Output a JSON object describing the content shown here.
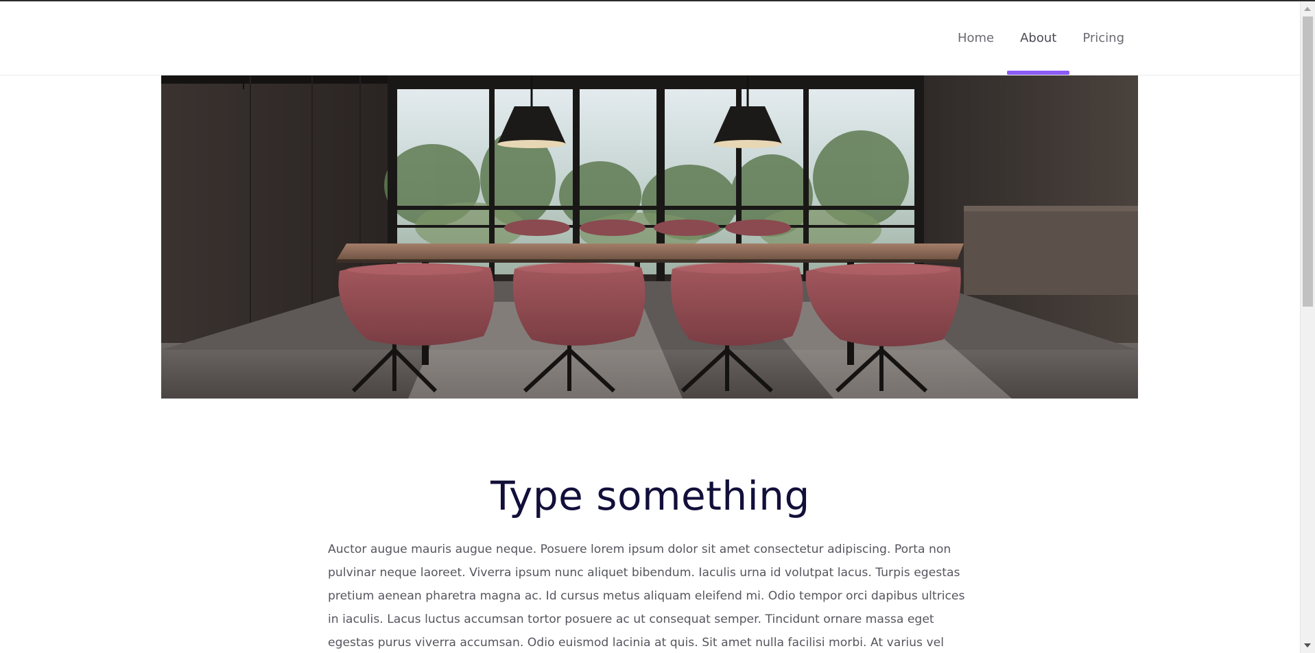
{
  "nav": {
    "items": [
      {
        "label": "Home"
      },
      {
        "label": "About"
      },
      {
        "label": "Pricing"
      }
    ],
    "active_index": 1,
    "accent_color": "#8b5cf6"
  },
  "hero": {
    "image": "meeting-room-photo"
  },
  "main": {
    "title": "Type something",
    "paragraph": "Auctor augue mauris augue neque. Posuere lorem ipsum dolor sit amet consectetur adipiscing. Porta non pulvinar neque laoreet. Viverra ipsum nunc aliquet bibendum. Iaculis urna id volutpat lacus. Turpis egestas pretium aenean pharetra magna ac. Id cursus metus aliquam eleifend mi. Odio tempor orci dapibus ultrices in iaculis. Lacus luctus accumsan tortor posuere ac ut consequat semper. Tincidunt ornare massa eget egestas purus viverra accumsan. Odio euismod lacinia at quis. Sit amet nulla facilisi morbi. At varius vel pharetra vel"
  },
  "colors": {
    "title": "#120f3a",
    "body_text": "#55555e",
    "nav_text": "#6a6a72"
  }
}
